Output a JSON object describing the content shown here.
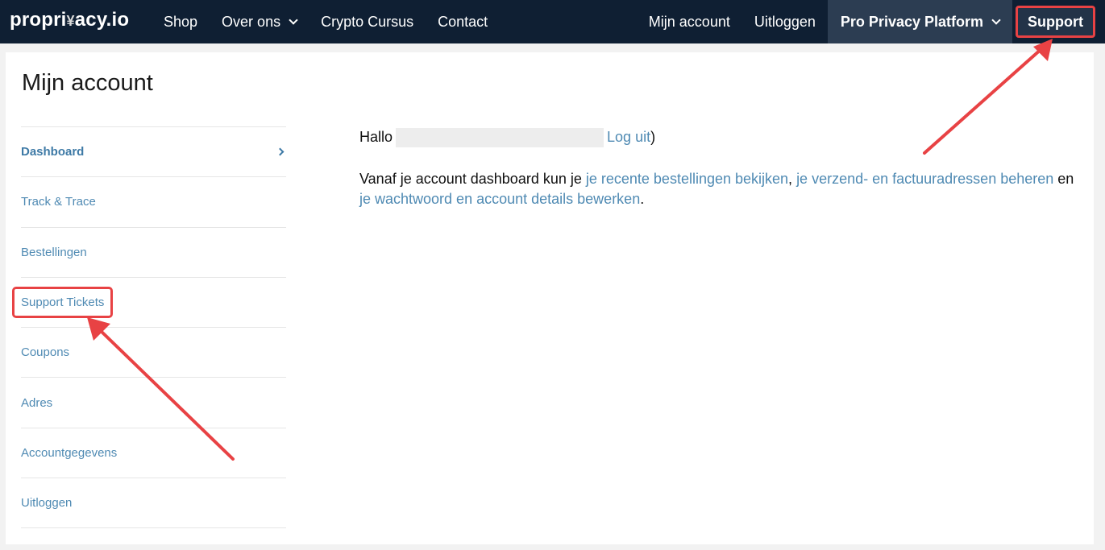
{
  "topbar": {
    "logo": {
      "left": "propri",
      "glyph": "¥",
      "right": "acy.io"
    },
    "nav_left": [
      {
        "label": "Shop",
        "dropdown": false
      },
      {
        "label": "Over ons",
        "dropdown": true
      },
      {
        "label": "Crypto Cursus",
        "dropdown": false
      },
      {
        "label": "Contact",
        "dropdown": false
      }
    ],
    "nav_right": {
      "mijn_account": "Mijn account",
      "uitloggen": "Uitloggen",
      "pro_platform": "Pro Privacy Platform",
      "support": "Support"
    }
  },
  "page": {
    "title": "Mijn account"
  },
  "sidebar": {
    "items": [
      {
        "label": "Dashboard"
      },
      {
        "label": "Track & Trace"
      },
      {
        "label": "Bestellingen"
      },
      {
        "label": "Support Tickets"
      },
      {
        "label": "Coupons"
      },
      {
        "label": "Adres"
      },
      {
        "label": "Accountgegevens"
      },
      {
        "label": "Uitloggen"
      }
    ]
  },
  "main": {
    "greeting_prefix": "Hallo",
    "logout_link": "Log uit",
    "greeting_suffix": ")",
    "desc_prefix": "Vanaf je account dashboard kun je ",
    "link_orders": "je recente bestellingen bekijken",
    "sep1": ", ",
    "link_addresses": "je verzend- en factuuradressen beheren",
    "sep2": " en ",
    "link_password": "je wachtwoord en account details bewerken",
    "desc_suffix": "."
  },
  "colors": {
    "nav_bg": "#0f1f33",
    "link": "#4f8ab3",
    "annotation": "#e84244"
  }
}
